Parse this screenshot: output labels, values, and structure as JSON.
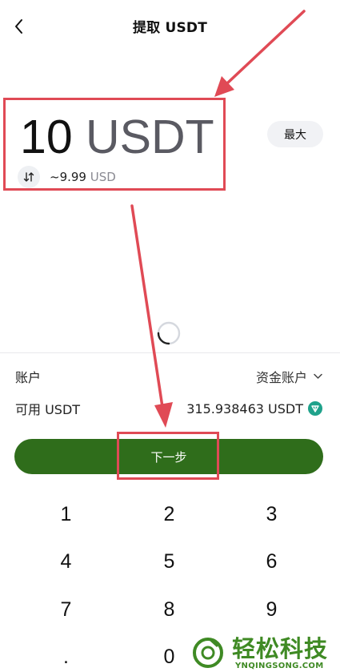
{
  "header": {
    "title": "提取 USDT",
    "back_icon": "chevron-left-icon"
  },
  "amount": {
    "value": "10",
    "currency": "USDT",
    "approx_value": "~9.99",
    "approx_unit": "USD",
    "swap_icon": "swap-arrows-icon"
  },
  "max_label": "最大",
  "account": {
    "label": "账户",
    "value": "资金账户",
    "dropdown_icon": "chevron-down-icon"
  },
  "available": {
    "label": "可用 USDT",
    "value": "315.938463 USDT",
    "token_icon": "usdt-token-icon"
  },
  "next_label": "下一步",
  "keypad": {
    "keys": [
      "1",
      "2",
      "3",
      "4",
      "5",
      "6",
      "7",
      "8",
      "9",
      ".",
      "0"
    ]
  },
  "watermark": {
    "text": "轻松科技",
    "subtext": "YNQINGSONG.COM"
  },
  "colors": {
    "primary_button": "#2f6d1b",
    "highlight_box": "#e04a55",
    "annotation_arrow": "#e04a55",
    "currency_text": "#5a5a62",
    "token": "#1fa28b",
    "watermark": "#3f8a24"
  }
}
